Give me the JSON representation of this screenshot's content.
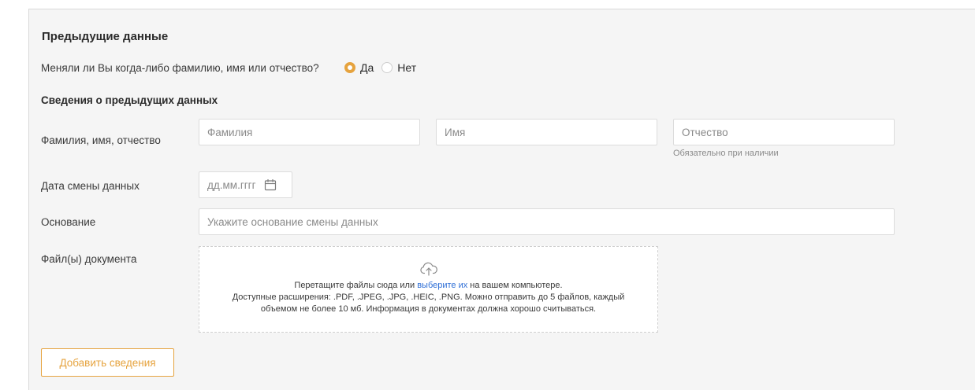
{
  "section": {
    "title": "Предыдущие данные",
    "question": "Меняли ли Вы когда-либо фамилию, имя или отчество?",
    "radio_yes": "Да",
    "radio_no": "Нет",
    "selected": "Да",
    "subtitle": "Сведения о предыдущих данных"
  },
  "fields": {
    "fio_label": "Фамилия, имя, отчество",
    "surname_placeholder": "Фамилия",
    "name_placeholder": "Имя",
    "patronymic_placeholder": "Отчество",
    "patronymic_hint": "Обязательно при наличии",
    "date_label": "Дата смены данных",
    "date_placeholder": "дд.мм.гггг",
    "reason_label": "Основание",
    "reason_placeholder": "Укажите основание смены данных",
    "file_label": "Файл(ы) документа"
  },
  "upload": {
    "line1_before": "Перетащите файлы сюда или ",
    "line1_link": "выберите их",
    "line1_after": " на вашем компьютере.",
    "line2": "Доступные расширения: .PDF, .JPEG, .JPG, .HEIC, .PNG. Можно отправить до 5 файлов, каждый",
    "line3": "объемом не более 10 мб. Информация в документах должна хорошо считываться."
  },
  "actions": {
    "add_label": "Добавить сведения"
  },
  "colors": {
    "accent": "#e6a33e",
    "link": "#2f6fd6",
    "panel_bg": "#f5f5f5"
  }
}
